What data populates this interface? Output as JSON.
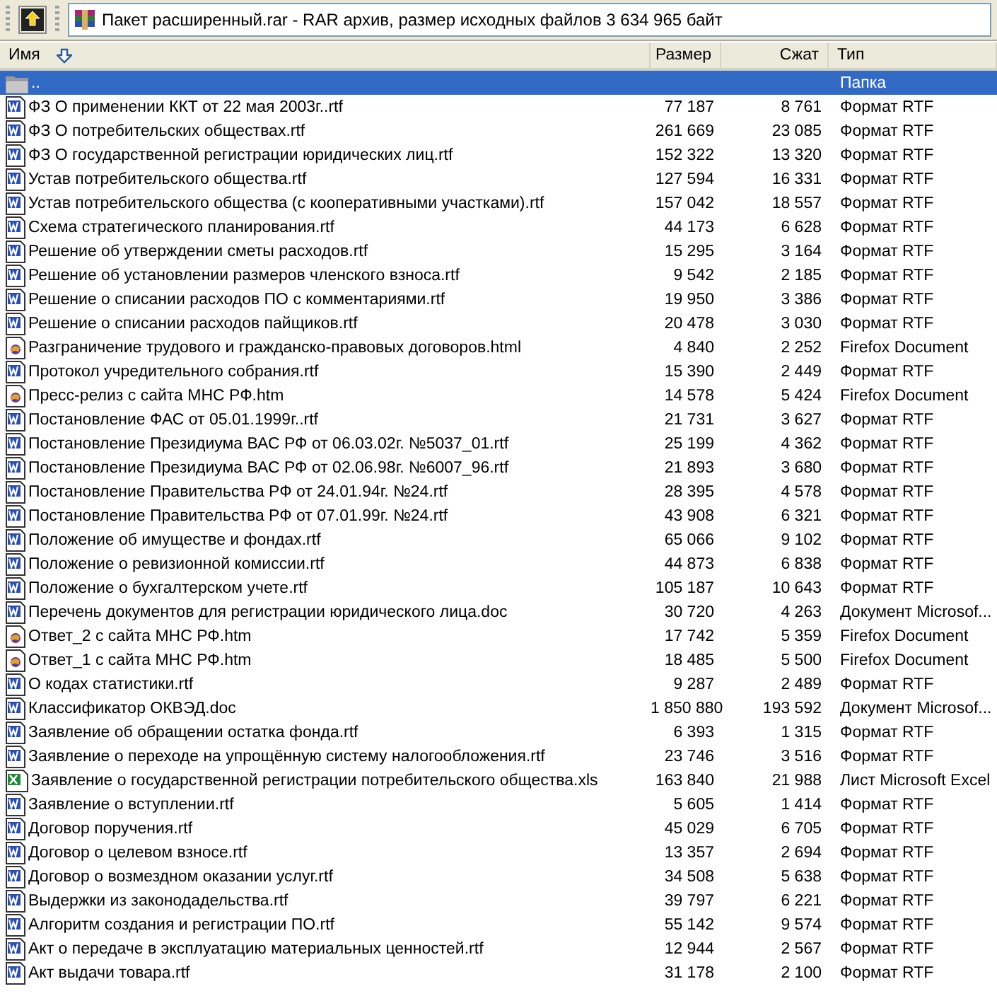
{
  "toolbar": {
    "address": "Пакет расширенный.rar - RAR архив, размер исходных файлов 3 634 965 байт"
  },
  "columns": [
    {
      "label": "Имя",
      "sorted": true
    },
    {
      "label": "Размер",
      "sorted": false
    },
    {
      "label": "Сжат",
      "sorted": false
    },
    {
      "label": "Тип",
      "sorted": false
    }
  ],
  "rows": [
    {
      "kind": "folder",
      "name": "..",
      "size": "",
      "packed": "",
      "type": "Папка",
      "selected": true
    },
    {
      "kind": "word",
      "name": "ФЗ О применении ККТ от 22 мая 2003г..rtf",
      "size": "77 187",
      "packed": "8 761",
      "type": "Формат RTF",
      "selected": false
    },
    {
      "kind": "word",
      "name": "ФЗ О потребительских обществах.rtf",
      "size": "261 669",
      "packed": "23 085",
      "type": "Формат RTF",
      "selected": false
    },
    {
      "kind": "word",
      "name": "ФЗ О государственной регистрации юридических лиц.rtf",
      "size": "152 322",
      "packed": "13 320",
      "type": "Формат RTF",
      "selected": false
    },
    {
      "kind": "word",
      "name": "Устав потребительского общества.rtf",
      "size": "127 594",
      "packed": "16 331",
      "type": "Формат RTF",
      "selected": false
    },
    {
      "kind": "word",
      "name": "Устав потребительского общества (с кооперативными участками).rtf",
      "size": "157 042",
      "packed": "18 557",
      "type": "Формат RTF",
      "selected": false
    },
    {
      "kind": "word",
      "name": "Схема стратегического планирования.rtf",
      "size": "44 173",
      "packed": "6 628",
      "type": "Формат RTF",
      "selected": false
    },
    {
      "kind": "word",
      "name": "Решение об утверждении сметы расходов.rtf",
      "size": "15 295",
      "packed": "3 164",
      "type": "Формат RTF",
      "selected": false
    },
    {
      "kind": "word",
      "name": "Решение об установлении размеров членского взноса.rtf",
      "size": "9 542",
      "packed": "2 185",
      "type": "Формат RTF",
      "selected": false
    },
    {
      "kind": "word",
      "name": "Решение о списании расходов ПО с комментариями.rtf",
      "size": "19 950",
      "packed": "3 386",
      "type": "Формат RTF",
      "selected": false
    },
    {
      "kind": "word",
      "name": "Решение о списании расходов пайщиков.rtf",
      "size": "20 478",
      "packed": "3 030",
      "type": "Формат RTF",
      "selected": false
    },
    {
      "kind": "html",
      "name": "Разграничение трудового и гражданско-правовых договоров.html",
      "size": "4 840",
      "packed": "2 252",
      "type": "Firefox Document",
      "selected": false
    },
    {
      "kind": "word",
      "name": "Протокол учредительного собрания.rtf",
      "size": "15 390",
      "packed": "2 449",
      "type": "Формат RTF",
      "selected": false
    },
    {
      "kind": "html",
      "name": "Пресс-релиз с сайта МНС РФ.htm",
      "size": "14 578",
      "packed": "5 424",
      "type": "Firefox Document",
      "selected": false
    },
    {
      "kind": "word",
      "name": "Постановление ФАС  от 05.01.1999г..rtf",
      "size": "21 731",
      "packed": "3 627",
      "type": "Формат RTF",
      "selected": false
    },
    {
      "kind": "word",
      "name": "Постановление Президиума ВАС РФ от 06.03.02г. №5037_01.rtf",
      "size": "25 199",
      "packed": "4 362",
      "type": "Формат RTF",
      "selected": false
    },
    {
      "kind": "word",
      "name": "Постановление Президиума ВАС РФ от 02.06.98г. №6007_96.rtf",
      "size": "21 893",
      "packed": "3 680",
      "type": "Формат RTF",
      "selected": false
    },
    {
      "kind": "word",
      "name": "Постановление Правительства РФ от 24.01.94г. №24.rtf",
      "size": "28 395",
      "packed": "4 578",
      "type": "Формат RTF",
      "selected": false
    },
    {
      "kind": "word",
      "name": "Постановление Правительства РФ от 07.01.99г. №24.rtf",
      "size": "43 908",
      "packed": "6 321",
      "type": "Формат RTF",
      "selected": false
    },
    {
      "kind": "word",
      "name": "Положение об имуществе и фондах.rtf",
      "size": "65 066",
      "packed": "9 102",
      "type": "Формат RTF",
      "selected": false
    },
    {
      "kind": "word",
      "name": "Положение о ревизионной комиссии.rtf",
      "size": "44 873",
      "packed": "6 838",
      "type": "Формат RTF",
      "selected": false
    },
    {
      "kind": "word",
      "name": "Положение о бухгалтерском учете.rtf",
      "size": "105 187",
      "packed": "10 643",
      "type": "Формат RTF",
      "selected": false
    },
    {
      "kind": "word",
      "name": "Перечень документов для регистрации юридического лица.doc",
      "size": "30 720",
      "packed": "4 263",
      "type": "Документ Microsof...",
      "selected": false
    },
    {
      "kind": "html",
      "name": "Ответ_2 с сайта МНС РФ.htm",
      "size": "17 742",
      "packed": "5 359",
      "type": "Firefox Document",
      "selected": false
    },
    {
      "kind": "html",
      "name": "Ответ_1 с сайта МНС РФ.htm",
      "size": "18 485",
      "packed": "5 500",
      "type": "Firefox Document",
      "selected": false
    },
    {
      "kind": "word",
      "name": "О кодах статистики.rtf",
      "size": "9 287",
      "packed": "2 489",
      "type": "Формат RTF",
      "selected": false
    },
    {
      "kind": "word",
      "name": "Классификатор ОКВЭД.doc",
      "size": "1 850 880",
      "packed": "193 592",
      "type": "Документ Microsof...",
      "selected": false
    },
    {
      "kind": "word",
      "name": "Заявление об обращении остатка фонда.rtf",
      "size": "6 393",
      "packed": "1 315",
      "type": "Формат RTF",
      "selected": false
    },
    {
      "kind": "word",
      "name": "Заявление о переходе на упрощённую систему налогообложения.rtf",
      "size": "23 746",
      "packed": "3 516",
      "type": "Формат RTF",
      "selected": false
    },
    {
      "kind": "excel",
      "name": "Заявление о государственной регистрации потребительского общества.xls",
      "size": "163 840",
      "packed": "21 988",
      "type": "Лист Microsoft Excel",
      "selected": false
    },
    {
      "kind": "word",
      "name": "Заявление о вступлении.rtf",
      "size": "5 605",
      "packed": "1 414",
      "type": "Формат RTF",
      "selected": false
    },
    {
      "kind": "word",
      "name": "Договор поручения.rtf",
      "size": "45 029",
      "packed": "6 705",
      "type": "Формат RTF",
      "selected": false
    },
    {
      "kind": "word",
      "name": "Договор о целевом взносе.rtf",
      "size": "13 357",
      "packed": "2 694",
      "type": "Формат RTF",
      "selected": false
    },
    {
      "kind": "word",
      "name": "Договор о возмездном оказании услуг.rtf",
      "size": "34 508",
      "packed": "5 638",
      "type": "Формат RTF",
      "selected": false
    },
    {
      "kind": "word",
      "name": "Выдержки из законодадельства.rtf",
      "size": "39 797",
      "packed": "6 221",
      "type": "Формат RTF",
      "selected": false
    },
    {
      "kind": "word",
      "name": "Алгоритм создания и регистрации ПО.rtf",
      "size": "55 142",
      "packed": "9 574",
      "type": "Формат RTF",
      "selected": false
    },
    {
      "kind": "word",
      "name": "Акт о передаче в эксплуатацию материальных ценностей.rtf",
      "size": "12 944",
      "packed": "2 567",
      "type": "Формат RTF",
      "selected": false
    },
    {
      "kind": "word",
      "name": "Акт выдачи товара.rtf",
      "size": "31 178",
      "packed": "2 100",
      "type": "Формат RTF",
      "selected": false
    }
  ]
}
